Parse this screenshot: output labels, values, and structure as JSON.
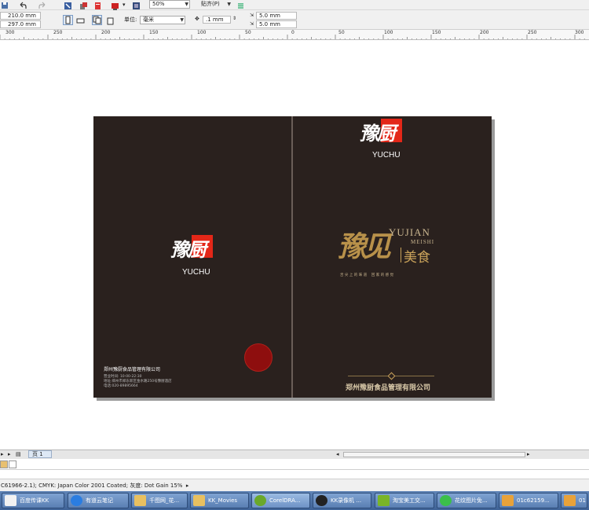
{
  "toolbar": {
    "zoom": "50%",
    "snap_label": "贴齐(P)"
  },
  "property_bar": {
    "width": "210.0 mm",
    "height": "297.0 mm",
    "units_label": "单位:",
    "units_value": "毫米",
    "nudge": ".1 mm",
    "dup_x": "5.0 mm",
    "dup_y": "5.0 mm"
  },
  "ruler": {
    "ticks": [
      "300",
      "250",
      "200",
      "150",
      "100",
      "50",
      "0",
      "50",
      "100",
      "150",
      "200",
      "250",
      "300"
    ]
  },
  "back_cover": {
    "logo_text": "豫厨",
    "logo_sub": "YUCHU",
    "company": "郑州豫厨食品管理有限公司",
    "hours": "营业时间: 10:00-22:30",
    "address": "地址:郑州市郑东新区金水路250号豫厨酒店",
    "phone": "电话:020-89895664"
  },
  "front_cover": {
    "logo_text": "豫厨",
    "logo_sub": "YUCHU",
    "calligraphy": "豫见",
    "title_en1": "YUJIAN",
    "title_en2": "MEISHI",
    "title_cn": "美食",
    "slogan": "舌 尖 上 的 味 道    回 家 的 感 觉",
    "company": "郑州豫厨食品管理有限公司"
  },
  "page_tabs": {
    "page1": "页 1"
  },
  "status": {
    "text": "C61966-2.1); CMYK: Japan Color 2001 Coated; 灰度: Dot Gain 15%"
  },
  "taskbar": {
    "items": [
      "百度传课KK",
      "有道云笔记",
      "千图网_花...",
      "KK_Movies",
      "CorelDRA...",
      "KK录像机 ...",
      "淘宝美工交...",
      "花纹图片免...",
      "01c62159...",
      "01"
    ]
  },
  "colors": {
    "page_bg": "#2a211e",
    "logo_red": "#e32718",
    "gold": "#c9a25a"
  }
}
